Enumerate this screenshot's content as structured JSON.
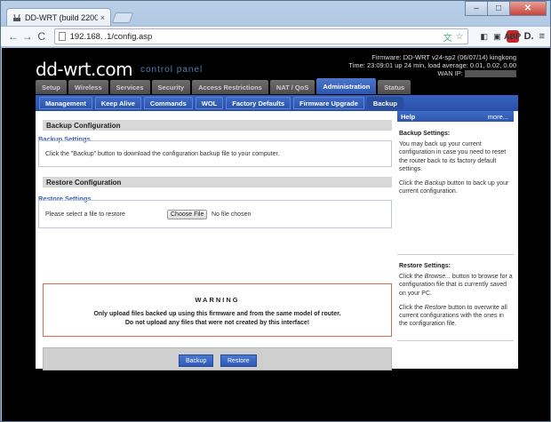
{
  "browser": {
    "tab_title": "DD-WRT (build 2200",
    "tab_close": "×",
    "window_buttons": [
      "–",
      "□",
      "✕"
    ],
    "nav_back": "←",
    "nav_forward": "→",
    "nav_reload": "C",
    "url": "192.168. .1/config.asp"
  },
  "header": {
    "logo": "dd-wrt.com",
    "subtitle": "control panel",
    "firmware_line": "Firmware: DD-WRT v24-sp2 (06/07/14) kingkong",
    "time_line": "Time: 23:09:01 up 24 min, load average: 0.01, 0.02, 0.00",
    "wan_label": "WAN IP:"
  },
  "main_tabs": [
    "Setup",
    "Wireless",
    "Services",
    "Security",
    "Access Restrictions",
    "NAT / QoS",
    "Administration",
    "Status"
  ],
  "main_tab_active": "Administration",
  "sub_tabs": [
    "Management",
    "Keep Alive",
    "Commands",
    "WOL",
    "Factory Defaults",
    "Firmware Upgrade",
    "Backup"
  ],
  "sub_tab_active": "Backup",
  "backup": {
    "heading": "Backup Configuration",
    "legend": "Backup Settings",
    "text": "Click the \"Backup\" button to download the configuration backup file to your computer."
  },
  "restore": {
    "heading": "Restore Configuration",
    "legend": "Restore Settings",
    "label": "Please select a file to restore",
    "choose_button": "Choose File",
    "no_file": "No file chosen"
  },
  "warning": {
    "title": "WARNING",
    "line1": "Only upload files backed up using this firmware and from the same model of router.",
    "line2": "Do not upload any files that were not created by this interface!"
  },
  "buttons": {
    "backup": "Backup",
    "restore": "Restore"
  },
  "help": {
    "title": "Help",
    "more": "more...",
    "backup_title": "Backup Settings:",
    "backup_p1": "You may back up your current configuration in case you need to reset the router back to its factory default settings.",
    "backup_p2a": "Click the ",
    "backup_p2b": "Backup",
    "backup_p2c": " button to back up your current configuration.",
    "restore_title": "Restore Settings:",
    "restore_p1a": "Click the ",
    "restore_p1b": "Browse...",
    "restore_p1c": " button to browse for a configuration file that is currently saved on your PC.",
    "restore_p2a": "Click the ",
    "restore_p2b": "Restore",
    "restore_p2c": " button to overwrite all current configurations with the ones in the configuration file."
  }
}
